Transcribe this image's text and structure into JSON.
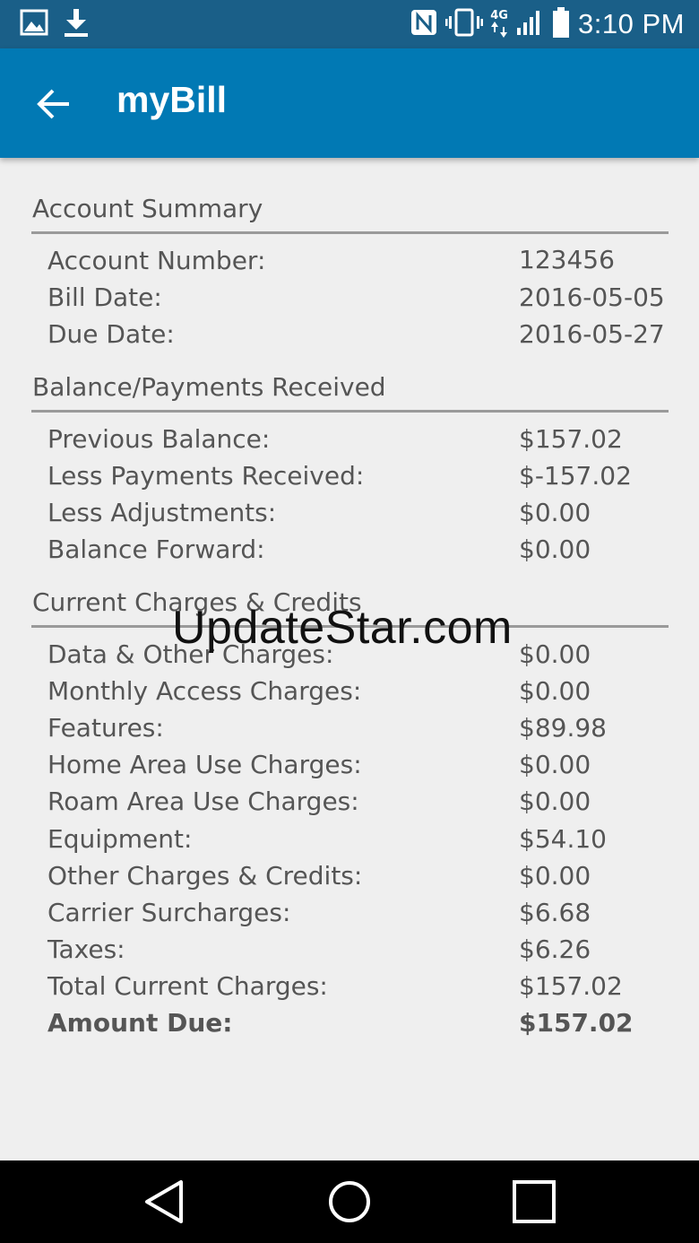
{
  "status_bar": {
    "time": "3:10 PM",
    "network": "4G",
    "icons": [
      "image-icon",
      "download-icon",
      "nfc-icon",
      "vibrate-icon",
      "network-4g-icon",
      "signal-icon",
      "battery-icon"
    ]
  },
  "app_bar": {
    "title": "myBill",
    "back_icon": "back-arrow-icon"
  },
  "sections": [
    {
      "title": "Account Summary",
      "rows": [
        {
          "label": "Account Number:",
          "value": "123456"
        },
        {
          "label": "Bill Date:",
          "value": "2016-05-05"
        },
        {
          "label": "Due Date:",
          "value": "2016-05-27"
        }
      ]
    },
    {
      "title": "Balance/Payments Received",
      "rows": [
        {
          "label": "Previous Balance:",
          "value": "$157.02"
        },
        {
          "label": "Less Payments Received:",
          "value": "$-157.02"
        },
        {
          "label": "Less Adjustments:",
          "value": "$0.00"
        },
        {
          "label": "Balance Forward:",
          "value": "$0.00"
        }
      ]
    },
    {
      "title": "Current Charges & Credits",
      "rows": [
        {
          "label": "Data & Other Charges:",
          "value": "$0.00"
        },
        {
          "label": "Monthly Access Charges:",
          "value": "$0.00"
        },
        {
          "label": "Features:",
          "value": "$89.98"
        },
        {
          "label": "Home Area Use Charges:",
          "value": "$0.00"
        },
        {
          "label": "Roam Area Use Charges:",
          "value": "$0.00"
        },
        {
          "label": "Equipment:",
          "value": "$54.10"
        },
        {
          "label": "Other Charges & Credits:",
          "value": "$0.00"
        },
        {
          "label": "Carrier Surcharges:",
          "value": "$6.68"
        },
        {
          "label": "Taxes:",
          "value": "$6.26"
        },
        {
          "label": "Total Current Charges:",
          "value": "$157.02"
        },
        {
          "label": "Amount Due:",
          "value": "$157.02"
        }
      ]
    }
  ],
  "watermark": "UpdateStar.com",
  "nav_bar": {
    "icons": [
      "back-triangle-icon",
      "home-circle-icon",
      "recents-square-icon"
    ]
  },
  "colors": {
    "status_bar": "#1a5f88",
    "app_bar": "#0179b4",
    "background": "#efefef",
    "text": "#555555",
    "divider": "#9a9a9a"
  }
}
